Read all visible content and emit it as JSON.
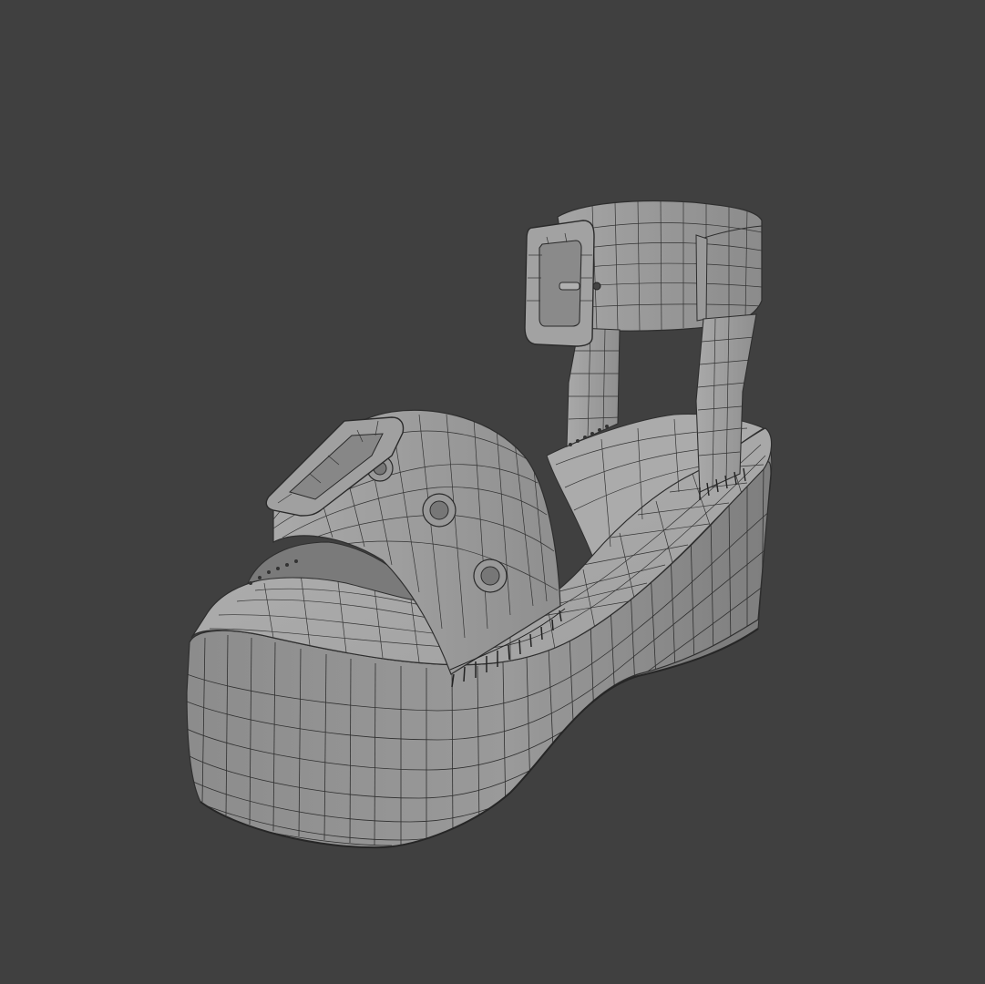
{
  "scene": {
    "subject": "platform-sandal-wireframe",
    "background_color": "#404040",
    "surface_light": "#a6a6a6",
    "surface_mid": "#8e8e8e",
    "surface_dark": "#6f6f6f",
    "wire_color": "#2e2e2e"
  }
}
